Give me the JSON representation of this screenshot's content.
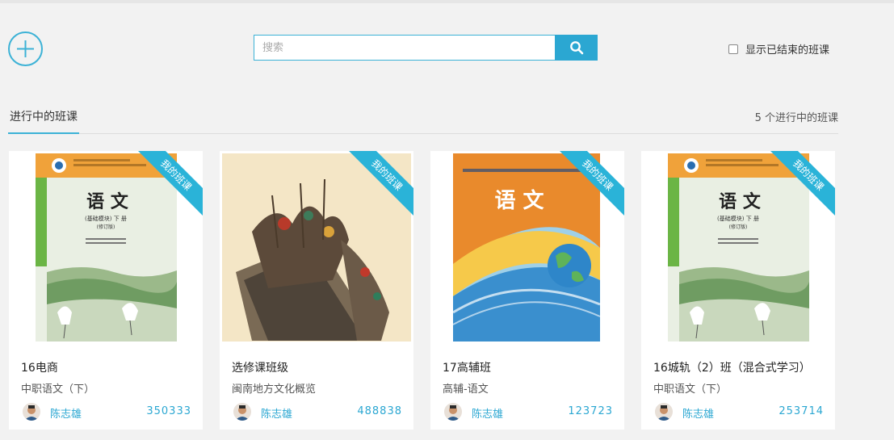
{
  "colors": {
    "accent": "#3cb2d6",
    "accent_dark": "#2ba7d2",
    "background": "#f2f2f2"
  },
  "toolbar": {
    "add_icon": "plus-circle-icon",
    "search_placeholder": "搜索",
    "search_icon": "search-icon",
    "show_ended_label": "显示已结束的班课",
    "show_ended_checked": false
  },
  "tabs": {
    "active_label": "进行中的班课",
    "count_label": "5 个进行中的班课"
  },
  "cards": [
    {
      "ribbon": "我的班课",
      "title": "16电商",
      "subtitle": "中职语文（下）",
      "teacher": "陈志雄",
      "code": "350333",
      "cover_title": "语  文",
      "cover_sub": "(基础模块) 下 册",
      "cover_ed": "(修订版)"
    },
    {
      "ribbon": "我的班课",
      "title": "选修课班级",
      "subtitle": "闽南地方文化概览",
      "teacher": "陈志雄",
      "code": "488838"
    },
    {
      "ribbon": "我的班课",
      "title": "17高辅班",
      "subtitle": "高辅-语文",
      "teacher": "陈志雄",
      "code": "123723",
      "cover_title": "语  文"
    },
    {
      "ribbon": "我的班课",
      "title": "16城轨（2）班（混合式学习）",
      "subtitle": "中职语文（下）",
      "teacher": "陈志雄",
      "code": "253714",
      "cover_title": "语  文",
      "cover_sub": "(基础模块) 下 册",
      "cover_ed": "(修订版)"
    }
  ]
}
